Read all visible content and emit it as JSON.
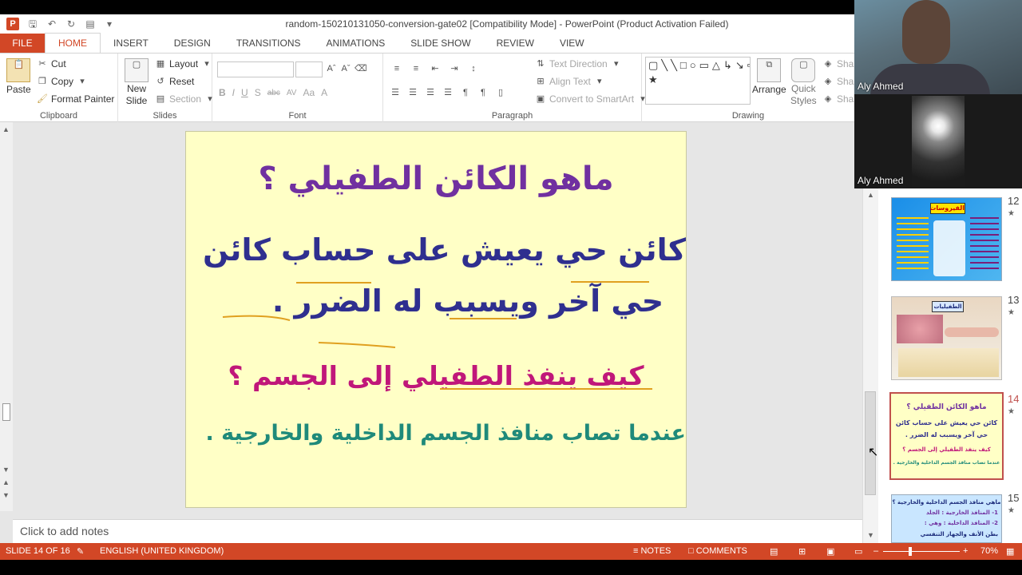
{
  "window": {
    "title": "random-150210131050-conversion-gate02 [Compatibility Mode] - PowerPoint (Product Activation Failed)"
  },
  "tabs": [
    "FILE",
    "HOME",
    "INSERT",
    "DESIGN",
    "TRANSITIONS",
    "ANIMATIONS",
    "SLIDE SHOW",
    "REVIEW",
    "VIEW"
  ],
  "ribbon": {
    "clipboard": {
      "paste": "Paste",
      "cut": "Cut",
      "copy": "Copy",
      "format_painter": "Format Painter",
      "label": "Clipboard"
    },
    "slides": {
      "new_slide_1": "New",
      "new_slide_2": "Slide",
      "layout": "Layout",
      "reset": "Reset",
      "section": "Section",
      "label": "Slides"
    },
    "font": {
      "label": "Font",
      "bold": "B",
      "italic": "I",
      "underline": "U",
      "shadow": "S",
      "strike": "abc",
      "spacing": "AV",
      "case": "Aa",
      "color": "A"
    },
    "paragraph": {
      "label": "Paragraph",
      "text_direction": "Text Direction",
      "align_text": "Align Text",
      "smartart": "Convert to SmartArt"
    },
    "drawing": {
      "label": "Drawing",
      "arrange": "Arrange",
      "quick_styles_1": "Quick",
      "quick_styles_2": "Styles",
      "shape_fill": "Shap",
      "shape_outline": "Shap",
      "shape_effects": "Shap"
    }
  },
  "slide": {
    "title": "ماهو الكائن الطفيلي ؟",
    "line1": "كائن حي يعيش على حساب كائن",
    "line2": "حي آخر ويسبب له الضرر .",
    "question": "كيف ينفذ الطفيلي إلى الجسم ؟",
    "answer": "عندما تصاب منافذ الجسم الداخلية والخارجية ."
  },
  "notes": {
    "placeholder": "Click to add notes"
  },
  "thumbnails": [
    {
      "num": "12",
      "title": "الفيروسات"
    },
    {
      "num": "13",
      "title": "الطفيليات"
    },
    {
      "num": "14",
      "title": "ماهو الكائن الطفيلي ؟",
      "l1": "كائن حي يعيش على حساب كائن",
      "l2": "حي آخر ويسبب له الضرر .",
      "l3": "كيف ينفذ الطفيلي إلى الجسم ؟",
      "l4": "عندما تصاب منافذ الجسم الداخلية والخارجية ."
    },
    {
      "num": "15",
      "title": "ماهي منافذ الجسم الداخلية والخارجية ؟",
      "l1": "1- المنافذ الخارجية : الجلد",
      "l2": "2- المنافذ الداخلية : وهي :",
      "l3": "بطن الأنف والجهاز التنفسي"
    }
  ],
  "video": {
    "participant1": "Aly Ahmed",
    "participant2": "Aly Ahmed"
  },
  "status": {
    "slide": "SLIDE 14 OF 16",
    "language": "ENGLISH (UNITED KINGDOM)",
    "notes": "NOTES",
    "comments": "COMMENTS",
    "zoom": "70%",
    "accent": "#d24726"
  }
}
